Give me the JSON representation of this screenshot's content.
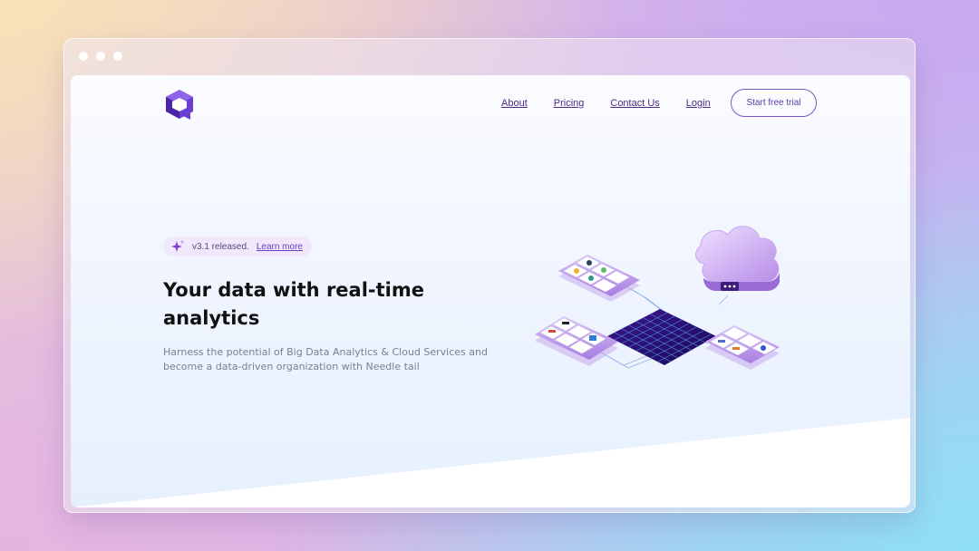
{
  "browser": {
    "window_dots": [
      "dot",
      "dot",
      "dot"
    ]
  },
  "brand": {
    "logo_icon": "needle-tail-logo-icon",
    "brand_color": "#6b3fd1"
  },
  "nav": {
    "items": [
      {
        "label": "About"
      },
      {
        "label": "Pricing"
      },
      {
        "label": "Contact Us"
      },
      {
        "label": "Login"
      }
    ],
    "cta_label": "Start free trial"
  },
  "hero": {
    "badge_icon": "sparkle-icon",
    "badge_text": "v3.1 released.",
    "badge_link": "Learn more",
    "title": "Your data with real-time analytics",
    "subtitle": "Harness the potential of Big Data Analytics & Cloud Services and become a data-driven organization with Needle tail"
  },
  "illustration": {
    "icon": "cloud-data-grid-illustration",
    "accent": "#7b4fd6"
  }
}
